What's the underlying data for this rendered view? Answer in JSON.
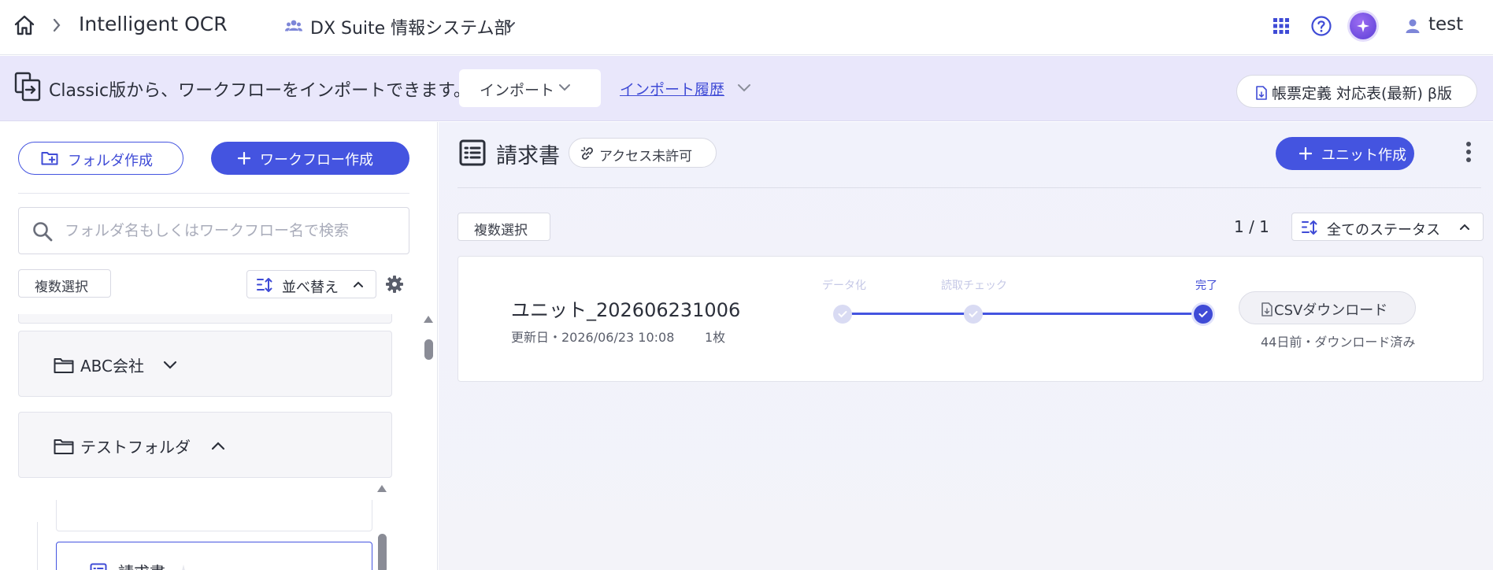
{
  "header": {
    "app_title": "Intelligent OCR",
    "org_name": "DX Suite 情報システム部",
    "user_name": "test"
  },
  "banner": {
    "message": "Classic版から、ワークフローをインポートできます。",
    "import_label": "インポート",
    "history_label": "インポート履歴",
    "definition_label": "帳票定義 対応表(最新) β版"
  },
  "sidebar": {
    "create_folder_label": "フォルダ作成",
    "create_workflow_label": "ワークフロー作成",
    "search_placeholder": "フォルダ名もしくはワークフロー名で検索",
    "multi_select_label": "複数選択",
    "sort_label": "並べ替え",
    "folders": [
      {
        "name": "ABC会社",
        "expanded": false
      },
      {
        "name": "テストフォルダ",
        "expanded": true
      }
    ],
    "workflows": [
      {
        "name": "請求書",
        "selected": true
      }
    ]
  },
  "main": {
    "title": "請求書",
    "access_label": "アクセス未許可",
    "create_unit_label": "ユニット作成",
    "multi_select_label": "複数選択",
    "page_count": "1 / 1",
    "status_filter_label": "全てのステータス",
    "units": [
      {
        "name": "ユニット_202606231006",
        "updated": "更新日・2026/06/23 10:08",
        "pages": "1枚",
        "steps": [
          {
            "label": "データ化",
            "state": "done-muted"
          },
          {
            "label": "読取チェック",
            "state": "done-muted"
          },
          {
            "label": "完了",
            "state": "current"
          }
        ],
        "csv_label": "CSVダウンロード",
        "download_status": "44日前・ダウンロード済み"
      }
    ]
  },
  "colors": {
    "accent": "#4454e0",
    "banner_bg": "#e9e7fb",
    "muted_step": "#c5c8e6"
  },
  "icons": [
    "home-icon",
    "chevron-right-icon",
    "group-icon",
    "chevron-down-icon",
    "apps-grid-icon",
    "help-icon",
    "ai-sparkle-icon",
    "user-icon",
    "import-icon",
    "file-icon",
    "folder-add-icon",
    "plus-icon",
    "search-icon",
    "sort-icon",
    "gear-icon",
    "folder-icon",
    "list-doc-icon",
    "sparkle-icon",
    "link-off-icon",
    "kebab-icon",
    "check-icon"
  ]
}
